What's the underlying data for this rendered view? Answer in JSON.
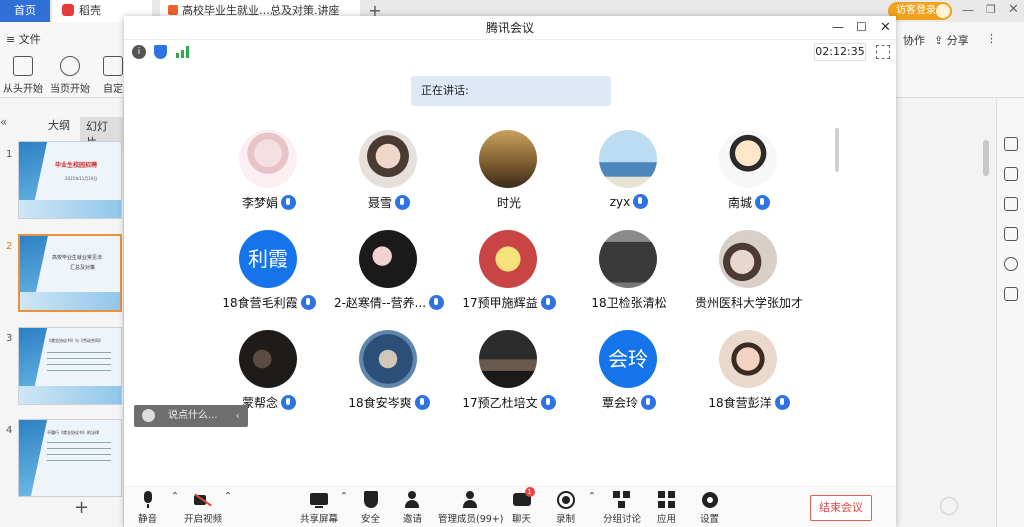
{
  "wps": {
    "tabs": {
      "home": "首页",
      "docer": "稻壳",
      "doc": "高校毕业生就业…总及对策.讲座",
      "plus": "+"
    },
    "visitor_login": "访客登录",
    "menu": {
      "file": "≡ 文件",
      "collab": "协作",
      "share": "分享"
    },
    "toolbar": {
      "from_start": "从头开始",
      "from_current": "当页开始",
      "custom": "自定"
    },
    "left_panel": {
      "tab_outline": "大纲",
      "tab_slides": "幻灯片",
      "slide_numbers": [
        "1",
        "2",
        "3",
        "4"
      ],
      "slide1_title": "毕业生校园招聘",
      "slide1_date": "2021年11月19日",
      "slide2_title": "高校毕业生就业常见法",
      "slide2_subtitle": "汇总及对策",
      "slide3_title": "《就业协议书》与《劳动合同》",
      "slide4_title": "不履行《就业协议书》的法律",
      "add": "+"
    }
  },
  "meeting": {
    "title": "腾讯会议",
    "timer": "02:12:35",
    "speaking_label": "正在讲话:",
    "participants": [
      {
        "name": "李梦娟",
        "avatar_text": ""
      },
      {
        "name": "聂雪",
        "avatar_text": ""
      },
      {
        "name": "时光",
        "avatar_text": ""
      },
      {
        "name": "zyx",
        "avatar_text": ""
      },
      {
        "name": "南城",
        "avatar_text": ""
      },
      {
        "name": "18食营毛利霞",
        "avatar_text": "利霞"
      },
      {
        "name": "2-赵寒倩--营养...",
        "avatar_text": ""
      },
      {
        "name": "17预甲施辉益",
        "avatar_text": ""
      },
      {
        "name": "18卫检张清松",
        "avatar_text": ""
      },
      {
        "name": "贵州医科大学张加才",
        "avatar_text": ""
      },
      {
        "name": "蒙帮念",
        "avatar_text": ""
      },
      {
        "name": "18食安岑爽",
        "avatar_text": ""
      },
      {
        "name": "17预乙杜培文",
        "avatar_text": ""
      },
      {
        "name": "覃会玲",
        "avatar_text": "会玲"
      },
      {
        "name": "18食营彭洋",
        "avatar_text": ""
      }
    ],
    "chat_placeholder": "说点什么...",
    "toolbar": {
      "mute": "静音",
      "video": "开启视频",
      "share_screen": "共享屏幕",
      "security": "安全",
      "invite": "邀请",
      "members": "管理成员(99+)",
      "chat": "聊天",
      "chat_badge": "1",
      "record": "录制",
      "breakout": "分组讨论",
      "apps": "应用",
      "settings": "设置",
      "end": "结束会议"
    }
  },
  "colors": {
    "accent": "#1674ea",
    "end_red": "#e04545",
    "wps_blue": "#2f6fd6"
  }
}
